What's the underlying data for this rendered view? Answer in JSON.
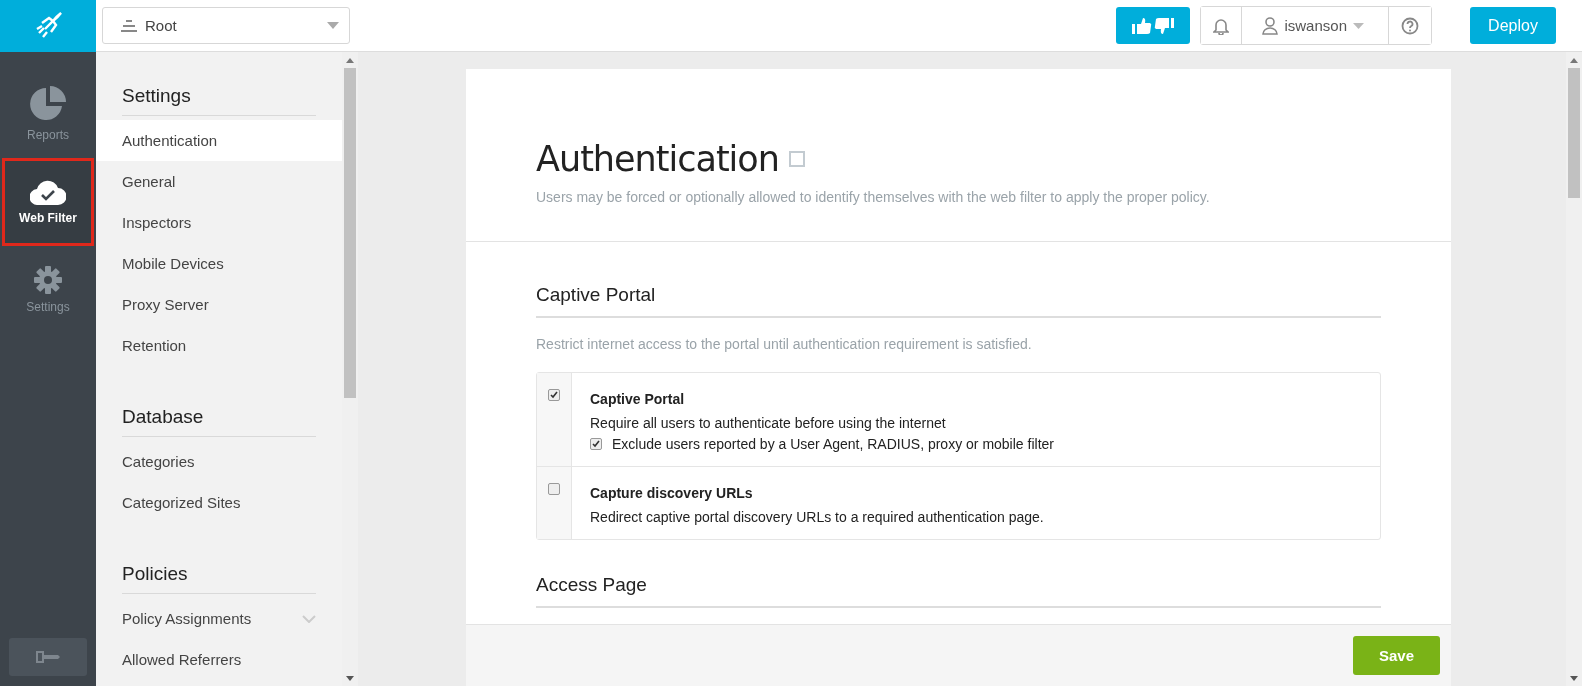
{
  "header": {
    "scope": "Root",
    "user": "iswanson",
    "deploy": "Deploy"
  },
  "rail": [
    {
      "label": "Reports",
      "kind": "reports",
      "selected": false,
      "annotated": false
    },
    {
      "label": "Web Filter",
      "kind": "webfilter",
      "selected": true,
      "annotated": true
    },
    {
      "label": "Settings",
      "kind": "settings",
      "selected": false,
      "annotated": false
    }
  ],
  "nav": [
    {
      "title": "Settings",
      "items": [
        {
          "label": "Authentication",
          "selected": true
        },
        {
          "label": "General",
          "selected": false
        },
        {
          "label": "Inspectors",
          "selected": false
        },
        {
          "label": "Mobile Devices",
          "selected": false
        },
        {
          "label": "Proxy Server",
          "selected": false
        },
        {
          "label": "Retention",
          "selected": false
        }
      ]
    },
    {
      "title": "Database",
      "items": [
        {
          "label": "Categories",
          "selected": false
        },
        {
          "label": "Categorized Sites",
          "selected": false
        }
      ]
    },
    {
      "title": "Policies",
      "items": [
        {
          "label": "Policy Assignments",
          "selected": false,
          "expandable": true
        },
        {
          "label": "Allowed Referrers",
          "selected": false
        }
      ]
    }
  ],
  "page": {
    "title": "Authentication",
    "description": "Users may be forced or optionally allowed to identify themselves with the web filter to apply the proper policy.",
    "sections": [
      {
        "title": "Captive Portal",
        "description": "Restrict internet access to the portal until authentication requirement is satisfied.",
        "options": [
          {
            "title": "Captive Portal",
            "checked": true,
            "text": "Require all users to authenticate before using the internet",
            "sub": [
              {
                "label": "Exclude users reported by a User Agent, RADIUS, proxy or mobile filter",
                "checked": true
              }
            ]
          },
          {
            "title": "Capture discovery URLs",
            "checked": false,
            "text": "Redirect captive portal discovery URLs to a required authentication page."
          }
        ]
      },
      {
        "title": "Access Page"
      }
    ]
  },
  "save": "Save"
}
